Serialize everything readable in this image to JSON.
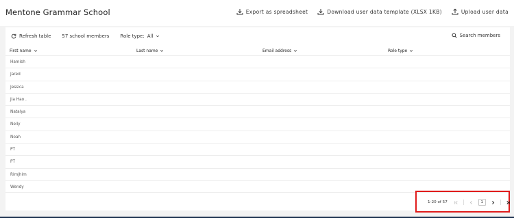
{
  "header": {
    "title": "Mentone Grammar School",
    "actions": [
      {
        "label": "Export as spreadsheet",
        "icon": "download-icon"
      },
      {
        "label": "Download user data template (XLSX 1KB)",
        "icon": "download-icon"
      },
      {
        "label": "Upload user data",
        "icon": "upload-icon"
      }
    ]
  },
  "toolbar": {
    "refresh_label": "Refresh table",
    "member_count": "57 school members",
    "role_filter_label": "Role type:",
    "role_filter_value": "All",
    "search_label": "Search members"
  },
  "table": {
    "columns": [
      "First name",
      "Last name",
      "Email address",
      "Role type"
    ],
    "rows": [
      {
        "first_name": "Hamish"
      },
      {
        "first_name": "Jared"
      },
      {
        "first_name": "Jessica"
      },
      {
        "first_name": "Jia Hao ."
      },
      {
        "first_name": "Natalya"
      },
      {
        "first_name": "Nelly"
      },
      {
        "first_name": "Noah"
      },
      {
        "first_name": "PT"
      },
      {
        "first_name": "PT"
      },
      {
        "first_name": "Rimjhim"
      },
      {
        "first_name": "Wendy"
      }
    ]
  },
  "pagination": {
    "range_text": "1-20 of 57",
    "current_page": "1"
  },
  "colors": {
    "highlight_box": "#e01b1b",
    "bottom_bar": "#1e3350"
  }
}
